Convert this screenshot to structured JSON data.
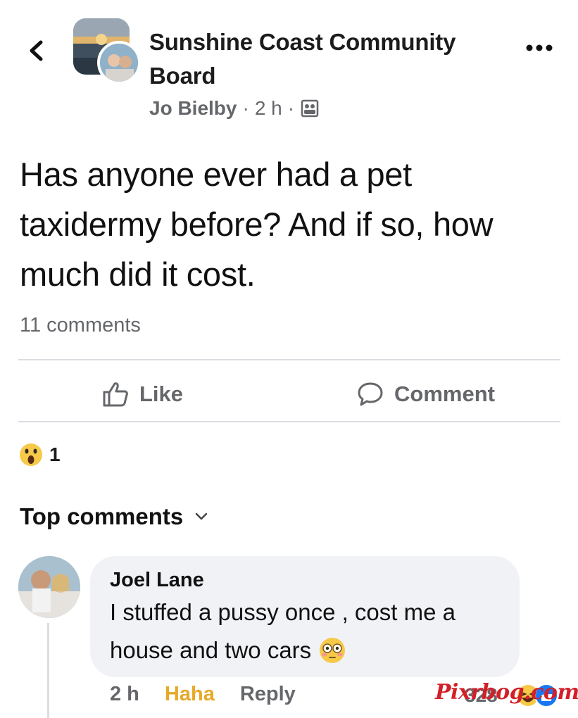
{
  "header": {
    "group_name": "Sunshine Coast Community Board",
    "author": "Jo Bielby",
    "time": "2 h",
    "separator": "·"
  },
  "post": {
    "text": "Has anyone ever had a pet taxidermy before? And if so, how much did it cost.",
    "comment_count": "11 comments"
  },
  "actions": {
    "like_label": "Like",
    "comment_label": "Comment"
  },
  "reactions": {
    "count": "1",
    "type": "wow-emoji-icon"
  },
  "comments_section": {
    "title": "Top comments"
  },
  "comment": {
    "author": "Joel Lane",
    "text_line1": "I stuffed a pussy once , cost me a",
    "text_line2": "house and two cars",
    "time": "2 h",
    "reaction_label": "Haha",
    "reply_label": "Reply",
    "reaction_count": "328"
  },
  "watermark": "Pixrbog.com",
  "colors": {
    "secondary_text": "#65676b",
    "bubble": "#f0f2f5",
    "haha": "#e7a928",
    "watermark": "#d31f28"
  }
}
